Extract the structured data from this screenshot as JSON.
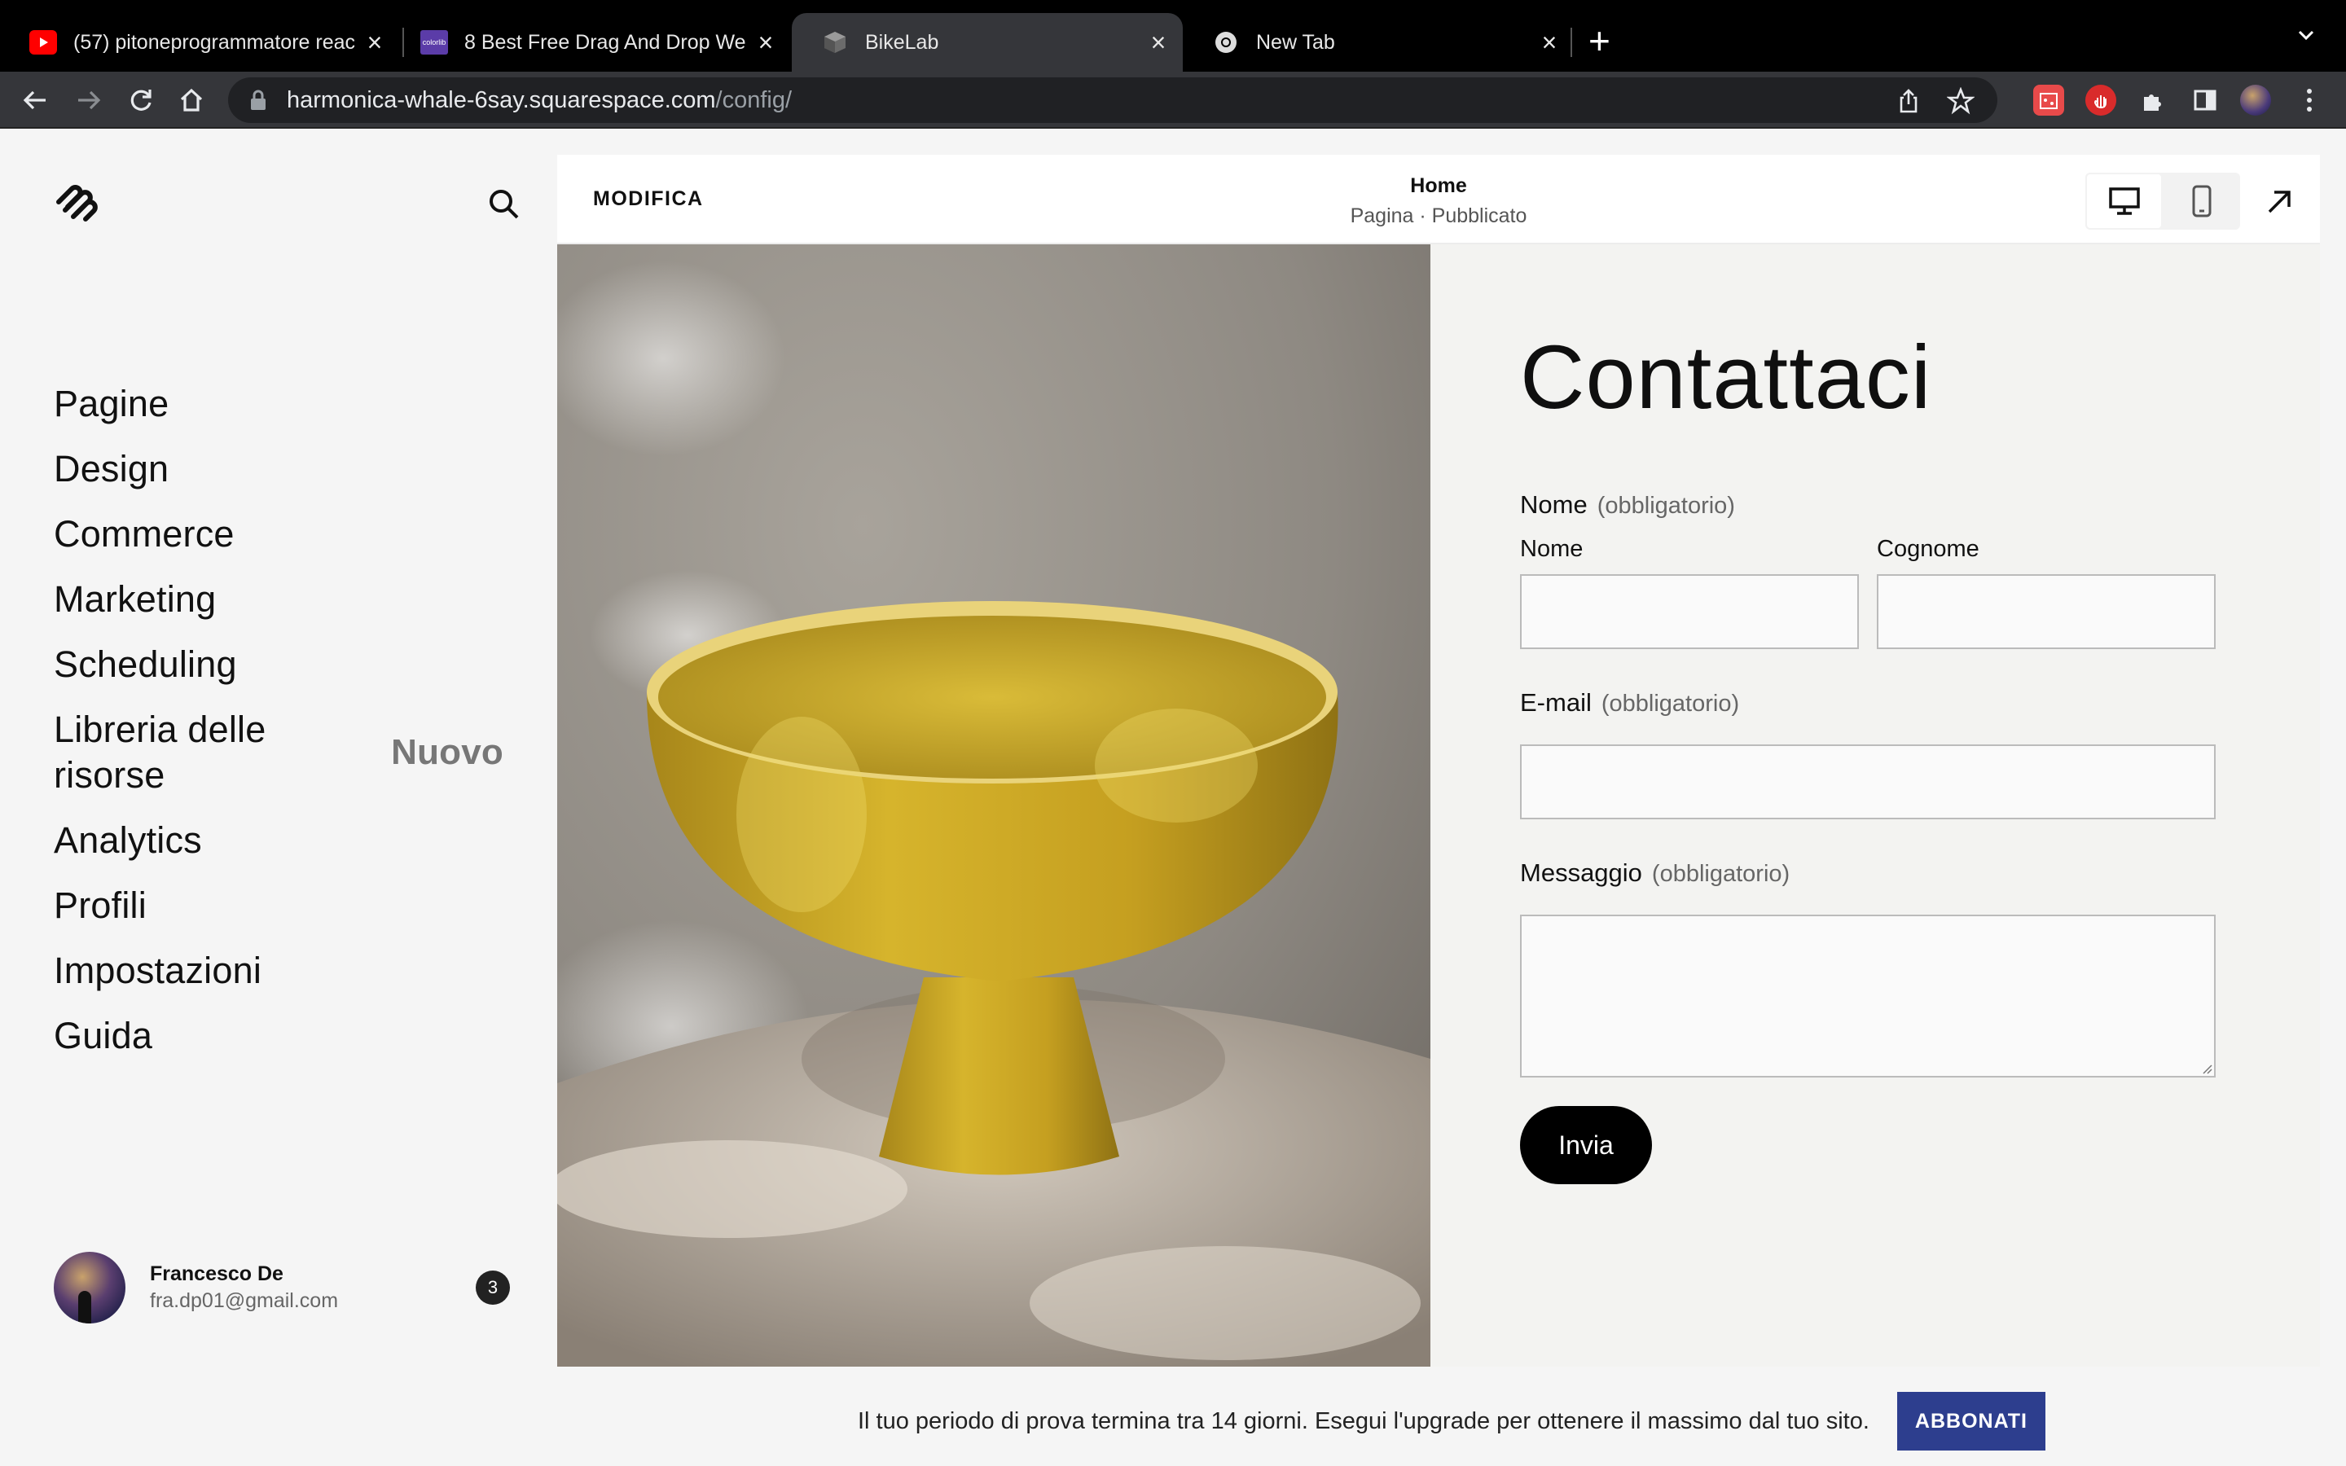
{
  "browser": {
    "tabs": [
      {
        "title": "(57) pitoneprogrammatore reac",
        "favicon": "youtube-icon"
      },
      {
        "title": "8 Best Free Drag And Drop We",
        "favicon": "colorlib-icon"
      },
      {
        "title": "BikeLab",
        "favicon": "squarespace-cube-icon"
      },
      {
        "title": "New Tab",
        "favicon": "chrome-icon"
      }
    ],
    "url_host": "harmonica-whale-6say.squarespace.com",
    "url_path": "/config/"
  },
  "sidebar": {
    "menu": [
      "Pagine",
      "Design",
      "Commerce",
      "Marketing",
      "Scheduling",
      "Libreria delle risorse",
      "Analytics",
      "Profili",
      "Impostazioni",
      "Guida"
    ],
    "new_badge": "Nuovo",
    "account": {
      "name": "Francesco De",
      "email": "fra.dp01@gmail.com",
      "notifications": "3"
    }
  },
  "editor": {
    "edit_label": "MODIFICA",
    "page_title": "Home",
    "page_status": "Pagina · Pubblicato"
  },
  "form": {
    "title": "Contattaci",
    "name_label": "Nome",
    "required": "(obbligatorio)",
    "first_name": "Nome",
    "last_name": "Cognome",
    "email_label": "E-mail",
    "message_label": "Messaggio",
    "submit": "Invia"
  },
  "trial": {
    "text": "Il tuo periodo di prova termina tra 14 giorni. Esegui l'upgrade per ottenere il massimo dal tuo sito.",
    "button": "ABBONATI"
  },
  "colors": {
    "trial_button": "#2d3e8e",
    "bowl": "#c9a521",
    "form_bg": "#f3f3f1"
  }
}
